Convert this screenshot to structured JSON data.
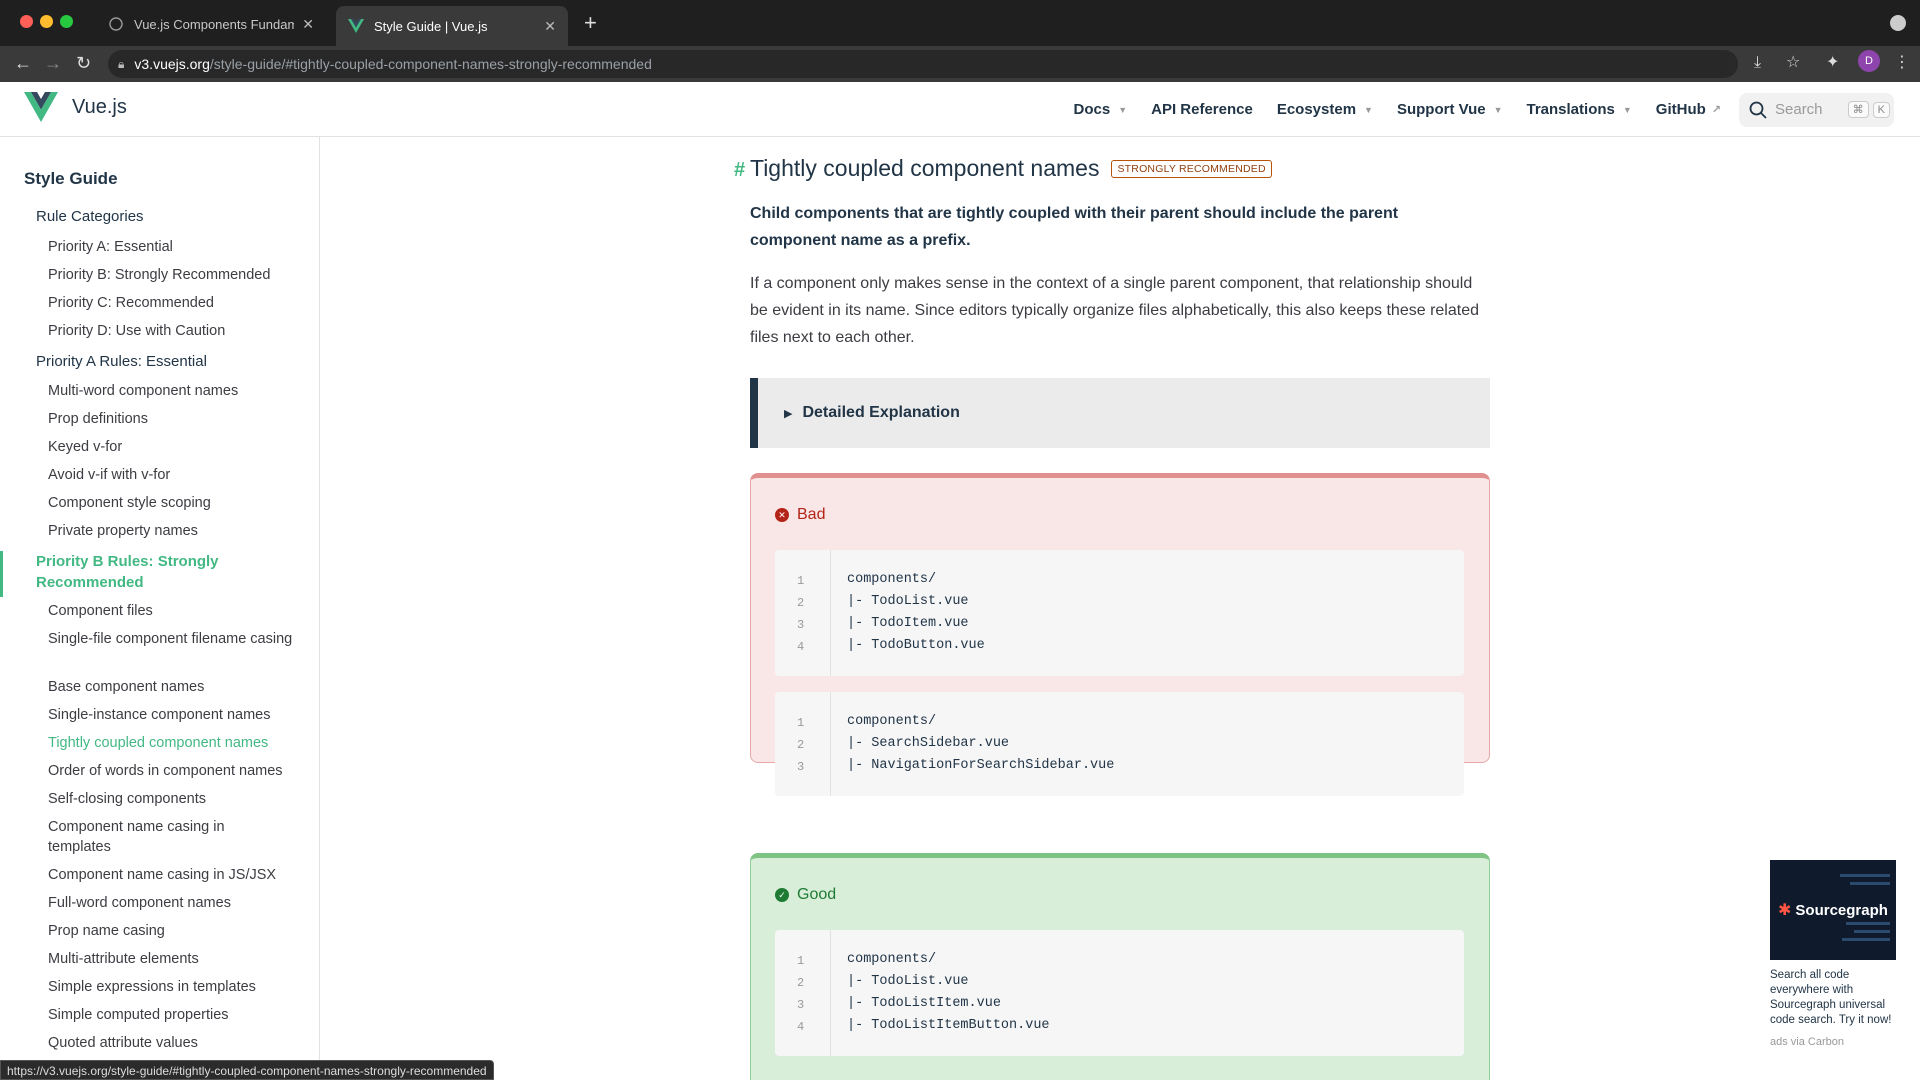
{
  "browser": {
    "tabs": [
      {
        "title": "Vue.js Components Fundamentals",
        "active": false
      },
      {
        "title": "Style Guide | Vue.js",
        "active": true
      }
    ],
    "url_host": "v3.vuejs.org",
    "url_path": "/style-guide/#tightly-coupled-component-names-strongly-recommended",
    "profile_initial": "D",
    "status_url": "https://v3.vuejs.org/style-guide/#tightly-coupled-component-names-strongly-recommended"
  },
  "header": {
    "logo_text": "Vue.js",
    "nav": {
      "docs": "Docs",
      "api": "API Reference",
      "ecosystem": "Ecosystem",
      "support": "Support Vue",
      "translations": "Translations",
      "github": "GitHub"
    },
    "search_placeholder": "Search",
    "kbd_cmd": "⌘",
    "kbd_k": "K"
  },
  "sidebar": {
    "title": "Style Guide",
    "items": [
      {
        "label": "Rule Categories",
        "level": "cat"
      },
      {
        "label": "Priority A: Essential",
        "level": "sub"
      },
      {
        "label": "Priority B: Strongly Recommended",
        "level": "sub"
      },
      {
        "label": "Priority C: Recommended",
        "level": "sub"
      },
      {
        "label": "Priority D: Use with Caution",
        "level": "sub"
      },
      {
        "label": "Priority A Rules: Essential",
        "level": "cat"
      },
      {
        "label": "Multi-word component names",
        "level": "sub"
      },
      {
        "label": "Prop definitions",
        "level": "sub"
      },
      {
        "label": "Keyed v-for",
        "level": "sub"
      },
      {
        "label": "Avoid v-if with v-for",
        "level": "sub"
      },
      {
        "label": "Component style scoping",
        "level": "sub"
      },
      {
        "label": "Private property names",
        "level": "sub"
      },
      {
        "label": "Priority B Rules: Strongly Recommended",
        "level": "active-cat"
      },
      {
        "label": "Component files",
        "level": "sub"
      },
      {
        "label": "Single-file component filename casing",
        "level": "sub"
      },
      {
        "label": "Base component names",
        "level": "sub"
      },
      {
        "label": "Single-instance component names",
        "level": "sub"
      },
      {
        "label": "Tightly coupled component names",
        "level": "active"
      },
      {
        "label": "Order of words in component names",
        "level": "sub"
      },
      {
        "label": "Self-closing components",
        "level": "sub"
      },
      {
        "label": "Component name casing in templates",
        "level": "sub"
      },
      {
        "label": "Component name casing in JS/JSX",
        "level": "sub"
      },
      {
        "label": "Full-word component names",
        "level": "sub"
      },
      {
        "label": "Prop name casing",
        "level": "sub"
      },
      {
        "label": "Multi-attribute elements",
        "level": "sub"
      },
      {
        "label": "Simple expressions in templates",
        "level": "sub"
      },
      {
        "label": "Simple computed properties",
        "level": "sub"
      },
      {
        "label": "Quoted attribute values",
        "level": "sub"
      }
    ]
  },
  "content": {
    "hash": "#",
    "heading": "Tightly coupled component names",
    "badge": "STRONGLY RECOMMENDED",
    "lead": "Child components that are tightly coupled with their parent should include the parent component name as a prefix.",
    "paragraph": "If a component only makes sense in the context of a single parent component, that relationship should be evident in its name. Since editors typically organize files alphabetically, this also keeps these related files next to each other.",
    "details_label": "Detailed Explanation",
    "bad": {
      "label": "Bad",
      "blocks": [
        [
          "components/",
          "|- TodoList.vue",
          "|- TodoItem.vue",
          "|- TodoButton.vue"
        ],
        [
          "components/",
          "|- SearchSidebar.vue",
          "|- NavigationForSearchSidebar.vue"
        ]
      ]
    },
    "good": {
      "label": "Good",
      "blocks": [
        [
          "components/",
          "|- TodoList.vue",
          "|- TodoListItem.vue",
          "|- TodoListItemButton.vue"
        ]
      ]
    }
  },
  "ad": {
    "brand": "Sourcegraph",
    "text": "Search all code everywhere with Sourcegraph universal code search. Try it now!",
    "via": "ads via Carbon"
  }
}
